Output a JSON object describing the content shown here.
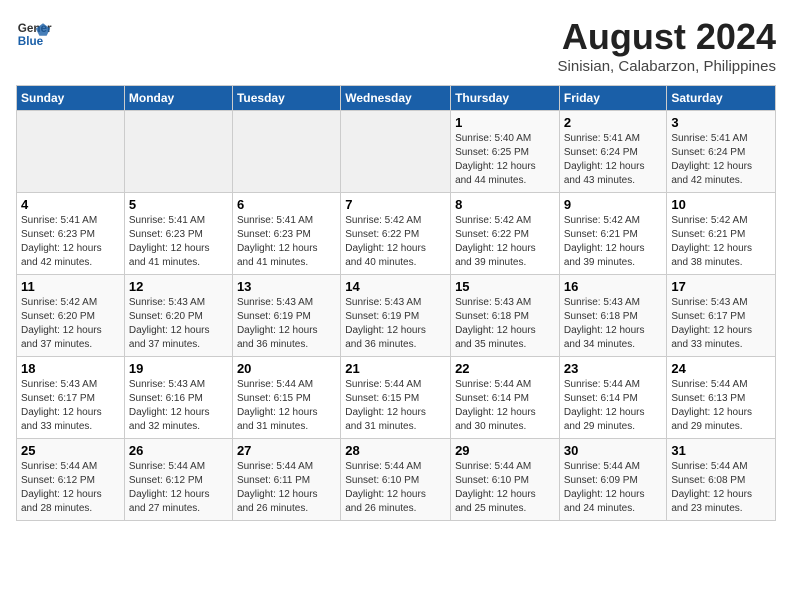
{
  "header": {
    "logo_line1": "General",
    "logo_line2": "Blue",
    "main_title": "August 2024",
    "subtitle": "Sinisian, Calabarzon, Philippines"
  },
  "days_of_week": [
    "Sunday",
    "Monday",
    "Tuesday",
    "Wednesday",
    "Thursday",
    "Friday",
    "Saturday"
  ],
  "weeks": [
    [
      {
        "day": "",
        "info": ""
      },
      {
        "day": "",
        "info": ""
      },
      {
        "day": "",
        "info": ""
      },
      {
        "day": "",
        "info": ""
      },
      {
        "day": "1",
        "info": "Sunrise: 5:40 AM\nSunset: 6:25 PM\nDaylight: 12 hours\nand 44 minutes."
      },
      {
        "day": "2",
        "info": "Sunrise: 5:41 AM\nSunset: 6:24 PM\nDaylight: 12 hours\nand 43 minutes."
      },
      {
        "day": "3",
        "info": "Sunrise: 5:41 AM\nSunset: 6:24 PM\nDaylight: 12 hours\nand 42 minutes."
      }
    ],
    [
      {
        "day": "4",
        "info": "Sunrise: 5:41 AM\nSunset: 6:23 PM\nDaylight: 12 hours\nand 42 minutes."
      },
      {
        "day": "5",
        "info": "Sunrise: 5:41 AM\nSunset: 6:23 PM\nDaylight: 12 hours\nand 41 minutes."
      },
      {
        "day": "6",
        "info": "Sunrise: 5:41 AM\nSunset: 6:23 PM\nDaylight: 12 hours\nand 41 minutes."
      },
      {
        "day": "7",
        "info": "Sunrise: 5:42 AM\nSunset: 6:22 PM\nDaylight: 12 hours\nand 40 minutes."
      },
      {
        "day": "8",
        "info": "Sunrise: 5:42 AM\nSunset: 6:22 PM\nDaylight: 12 hours\nand 39 minutes."
      },
      {
        "day": "9",
        "info": "Sunrise: 5:42 AM\nSunset: 6:21 PM\nDaylight: 12 hours\nand 39 minutes."
      },
      {
        "day": "10",
        "info": "Sunrise: 5:42 AM\nSunset: 6:21 PM\nDaylight: 12 hours\nand 38 minutes."
      }
    ],
    [
      {
        "day": "11",
        "info": "Sunrise: 5:42 AM\nSunset: 6:20 PM\nDaylight: 12 hours\nand 37 minutes."
      },
      {
        "day": "12",
        "info": "Sunrise: 5:43 AM\nSunset: 6:20 PM\nDaylight: 12 hours\nand 37 minutes."
      },
      {
        "day": "13",
        "info": "Sunrise: 5:43 AM\nSunset: 6:19 PM\nDaylight: 12 hours\nand 36 minutes."
      },
      {
        "day": "14",
        "info": "Sunrise: 5:43 AM\nSunset: 6:19 PM\nDaylight: 12 hours\nand 36 minutes."
      },
      {
        "day": "15",
        "info": "Sunrise: 5:43 AM\nSunset: 6:18 PM\nDaylight: 12 hours\nand 35 minutes."
      },
      {
        "day": "16",
        "info": "Sunrise: 5:43 AM\nSunset: 6:18 PM\nDaylight: 12 hours\nand 34 minutes."
      },
      {
        "day": "17",
        "info": "Sunrise: 5:43 AM\nSunset: 6:17 PM\nDaylight: 12 hours\nand 33 minutes."
      }
    ],
    [
      {
        "day": "18",
        "info": "Sunrise: 5:43 AM\nSunset: 6:17 PM\nDaylight: 12 hours\nand 33 minutes."
      },
      {
        "day": "19",
        "info": "Sunrise: 5:43 AM\nSunset: 6:16 PM\nDaylight: 12 hours\nand 32 minutes."
      },
      {
        "day": "20",
        "info": "Sunrise: 5:44 AM\nSunset: 6:15 PM\nDaylight: 12 hours\nand 31 minutes."
      },
      {
        "day": "21",
        "info": "Sunrise: 5:44 AM\nSunset: 6:15 PM\nDaylight: 12 hours\nand 31 minutes."
      },
      {
        "day": "22",
        "info": "Sunrise: 5:44 AM\nSunset: 6:14 PM\nDaylight: 12 hours\nand 30 minutes."
      },
      {
        "day": "23",
        "info": "Sunrise: 5:44 AM\nSunset: 6:14 PM\nDaylight: 12 hours\nand 29 minutes."
      },
      {
        "day": "24",
        "info": "Sunrise: 5:44 AM\nSunset: 6:13 PM\nDaylight: 12 hours\nand 29 minutes."
      }
    ],
    [
      {
        "day": "25",
        "info": "Sunrise: 5:44 AM\nSunset: 6:12 PM\nDaylight: 12 hours\nand 28 minutes."
      },
      {
        "day": "26",
        "info": "Sunrise: 5:44 AM\nSunset: 6:12 PM\nDaylight: 12 hours\nand 27 minutes."
      },
      {
        "day": "27",
        "info": "Sunrise: 5:44 AM\nSunset: 6:11 PM\nDaylight: 12 hours\nand 26 minutes."
      },
      {
        "day": "28",
        "info": "Sunrise: 5:44 AM\nSunset: 6:10 PM\nDaylight: 12 hours\nand 26 minutes."
      },
      {
        "day": "29",
        "info": "Sunrise: 5:44 AM\nSunset: 6:10 PM\nDaylight: 12 hours\nand 25 minutes."
      },
      {
        "day": "30",
        "info": "Sunrise: 5:44 AM\nSunset: 6:09 PM\nDaylight: 12 hours\nand 24 minutes."
      },
      {
        "day": "31",
        "info": "Sunrise: 5:44 AM\nSunset: 6:08 PM\nDaylight: 12 hours\nand 23 minutes."
      }
    ]
  ]
}
